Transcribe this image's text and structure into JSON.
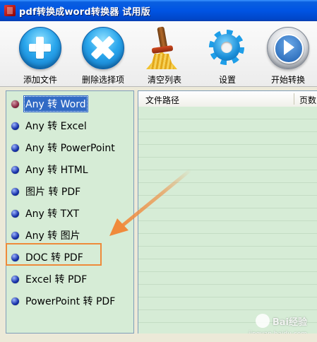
{
  "window": {
    "title": "pdf转换成word转换器 试用版"
  },
  "toolbar": {
    "add_file": "添加文件",
    "remove_selected": "删除选择项",
    "clear_list": "清空列表",
    "settings": "设置",
    "start_convert": "开始转换"
  },
  "conversion_types": [
    {
      "label": "Any 转 Word",
      "selected": true
    },
    {
      "label": "Any 转 Excel",
      "selected": false
    },
    {
      "label": "Any 转 PowerPoint",
      "selected": false
    },
    {
      "label": "Any 转 HTML",
      "selected": false
    },
    {
      "label": "图片 转 PDF",
      "selected": false
    },
    {
      "label": "Any 转 TXT",
      "selected": false
    },
    {
      "label": "Any 转 图片",
      "selected": false
    },
    {
      "label": "DOC 转 PDF",
      "selected": false
    },
    {
      "label": "Excel 转 PDF",
      "selected": false
    },
    {
      "label": "PowerPoint 转 PDF",
      "selected": false
    }
  ],
  "file_list": {
    "columns": [
      "文件路径",
      "页数"
    ]
  },
  "annotation": {
    "highlight_color": "#ee8a3a",
    "arrow_color": "#f08a3c"
  },
  "watermark": {
    "brand": "Bai经验",
    "url": "jingyan.baidu.com"
  }
}
